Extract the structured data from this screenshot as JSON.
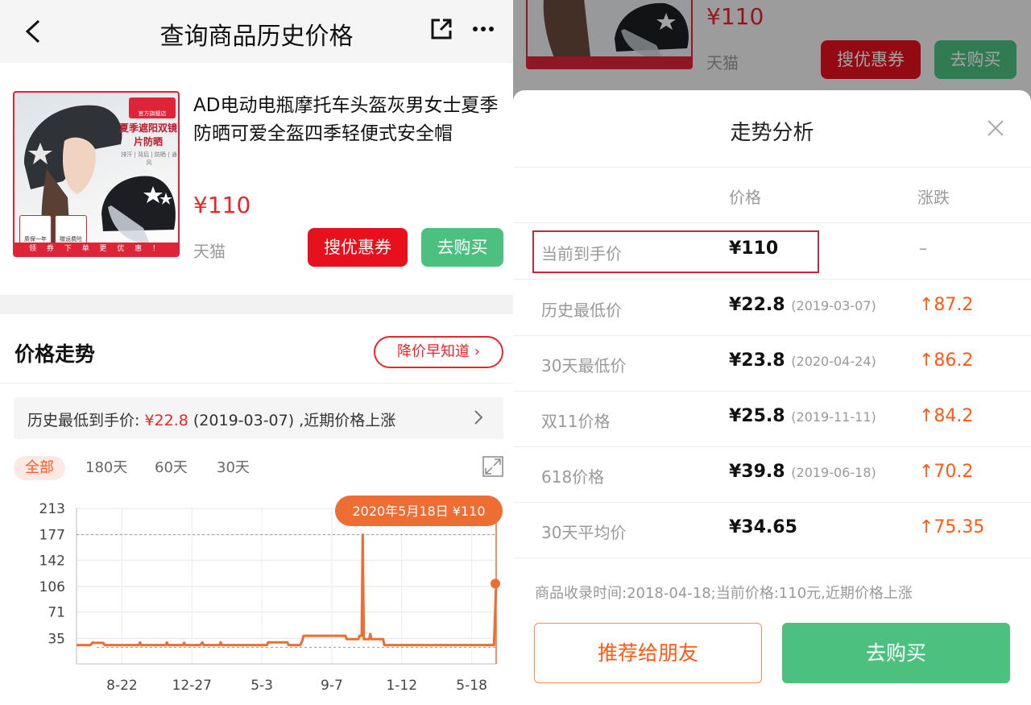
{
  "header": {
    "title": "查询商品历史价格"
  },
  "product": {
    "name": "AD电动电瓶摩托车头盔灰男女士夏季防晒可爱全盔四季轻便式安全帽",
    "price": "¥110",
    "store": "天猫",
    "image_texts": {
      "shop_badge": "官方旗舰店",
      "slogan": "夏季遮阳双镜片防晒",
      "sub": "排汗 | 背后 | 防晒 | 通风",
      "badge_1": "质保一年",
      "badge_2": "赠运费险",
      "badge_tag": "送",
      "ribbon": "领 券 下 单 更 优 惠 ！"
    }
  },
  "buttons": {
    "coupon": "搜优惠券",
    "buy": "去购买"
  },
  "trend": {
    "title": "价格走势",
    "alert_button": "降价早知道 ›",
    "history_prefix": "历史最低到手价: ",
    "history_price": "¥22.8",
    "history_suffix": " (2019-03-07) ,近期价格上涨",
    "ranges": [
      "全部",
      "180天",
      "60天",
      "30天"
    ]
  },
  "chart_data": {
    "type": "line",
    "tooltip": "2020年5月18日 ¥110",
    "y_ticks": [
      213,
      177,
      142,
      106,
      71,
      35
    ],
    "x_ticks": [
      "8-22",
      "12-27",
      "5-3",
      "9-7",
      "1-12",
      "5-18"
    ],
    "ylim": [
      0,
      213
    ],
    "max_reference": 177,
    "min_reference": 22.8,
    "series": [
      {
        "points": [
          [
            0,
            25.8
          ],
          [
            0.3,
            25.8
          ],
          [
            1.3,
            25.8
          ],
          [
            1.5,
            29.5
          ],
          [
            1.6,
            28.8
          ],
          [
            2.5,
            28.8
          ],
          [
            2.6,
            25.8
          ],
          [
            5.8,
            25.8
          ],
          [
            5.9,
            29.5
          ],
          [
            6,
            25.8
          ],
          [
            7.3,
            25.8
          ],
          [
            8.3,
            25.8
          ],
          [
            8.4,
            29.5
          ],
          [
            8.5,
            25.8
          ],
          [
            9.9,
            25.8
          ],
          [
            10,
            29
          ],
          [
            10.1,
            25.8
          ],
          [
            11.5,
            25.8
          ],
          [
            11.7,
            29.5
          ],
          [
            11.8,
            25.8
          ],
          [
            12.3,
            25.8
          ],
          [
            13.3,
            25.8
          ],
          [
            13.4,
            29.5
          ],
          [
            13.5,
            25.8
          ],
          [
            16.2,
            25.8
          ],
          [
            17.7,
            25.8
          ],
          [
            17.8,
            29.5
          ],
          [
            19.6,
            29.5
          ],
          [
            19.7,
            25.8
          ],
          [
            20.8,
            25.8
          ],
          [
            21,
            32.5
          ],
          [
            21.1,
            38.5
          ],
          [
            25,
            38.5
          ],
          [
            25.1,
            34
          ],
          [
            25.5,
            34
          ],
          [
            26.2,
            34
          ],
          [
            26.3,
            38.5
          ],
          [
            26.5,
            38.5
          ],
          [
            26.6,
            177
          ],
          [
            26.7,
            34
          ],
          [
            27.2,
            34
          ],
          [
            27.3,
            41
          ],
          [
            27.4,
            34
          ],
          [
            28.5,
            34
          ],
          [
            28.6,
            25.8
          ],
          [
            38.8,
            25.8
          ],
          [
            39,
            110
          ]
        ]
      }
    ]
  },
  "dialog": {
    "bg_price": "¥110",
    "bg_store": "天猫",
    "title": "走势分析",
    "columns": {
      "price": "价格",
      "change": "涨跌"
    },
    "rows": [
      {
        "label": "当前到手价",
        "price": "¥110",
        "date": "",
        "change": "–"
      },
      {
        "label": "历史最低价",
        "price": "¥22.8",
        "date": "(2019-03-07)",
        "change": "↑87.2"
      },
      {
        "label": "30天最低价",
        "price": "¥23.8",
        "date": "(2020-04-24)",
        "change": "↑86.2"
      },
      {
        "label": "双11价格",
        "price": "¥25.8",
        "date": "(2019-11-11)",
        "change": "↑84.2"
      },
      {
        "label": "618价格",
        "price": "¥39.8",
        "date": "(2019-06-18)",
        "change": "↑70.2"
      },
      {
        "label": "30天平均价",
        "price": "¥34.65",
        "date": "",
        "change": "↑75.35"
      }
    ],
    "footer_note": "商品收录时间:2018-04-18;当前价格:110元,近期价格上涨",
    "recommend_button": "推荐给朋友",
    "buy_button": "去购买"
  },
  "colors": {
    "accent_red": "#e8262a",
    "buy_green": "#4bc07f",
    "chart_orange": "#ee6d32",
    "change_orange": "#ff5a14"
  },
  "icons": [
    "back-arrow-icon",
    "share-icon",
    "more-icon",
    "chevron-right-icon",
    "expand-icon",
    "close-icon"
  ]
}
